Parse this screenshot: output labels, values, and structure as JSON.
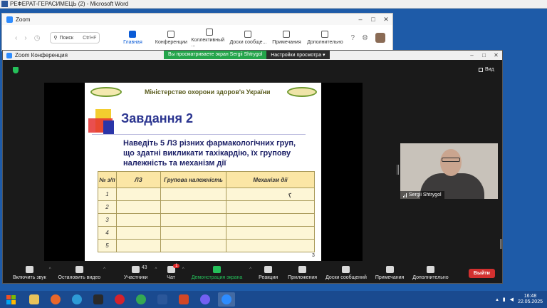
{
  "word": {
    "title": "РЕФЕРАТ-ГЕРАСИМЕЦЬ (2) - Microsoft Word"
  },
  "zoom_main": {
    "title": "Zoom",
    "search_label": "Поиск",
    "search_shortcut": "Ctrl+F",
    "tabs": [
      {
        "label": "Главная"
      },
      {
        "label": "Конференции"
      },
      {
        "label": "Коллективный ..."
      },
      {
        "label": "Доски сообще..."
      },
      {
        "label": "Примечания"
      },
      {
        "label": "Дополнительно"
      }
    ]
  },
  "meeting": {
    "title": "Zoom Конференция",
    "share_notice": "Вы просматриваете экран Sergii Shtrygol",
    "view_settings": "Настройки просмотра",
    "view_label": "Вид"
  },
  "slide": {
    "ministry": "Міністерство охорони здоров'я України",
    "task_title": "Завдання 2",
    "question": "Наведіть 5 ЛЗ різних фармакологічних груп, що здатні викликати тахікардію, їх групову належність та механізм дії",
    "table_headers": [
      "№ з/п",
      "ЛЗ",
      "Групова належність",
      "Механізм дії"
    ],
    "row_numbers": [
      "1",
      "2",
      "3",
      "4",
      "5"
    ],
    "page_number": "3"
  },
  "camera": {
    "participant": "Sergii Shtrygol"
  },
  "toolbar": {
    "mute": "Включить звук",
    "video": "Остановить видео",
    "participants": "Участники",
    "participants_count": "43",
    "chat": "Чат",
    "chat_badge": "1",
    "share": "Демонстрация экрана",
    "reactions": "Реакции",
    "apps": "Приложения",
    "whiteboards": "Доски сообщений",
    "notes": "Примечания",
    "more": "Дополнительно",
    "leave": "Выйти"
  },
  "taskbar": {
    "time": "16:48",
    "date": "22.05.2025"
  }
}
